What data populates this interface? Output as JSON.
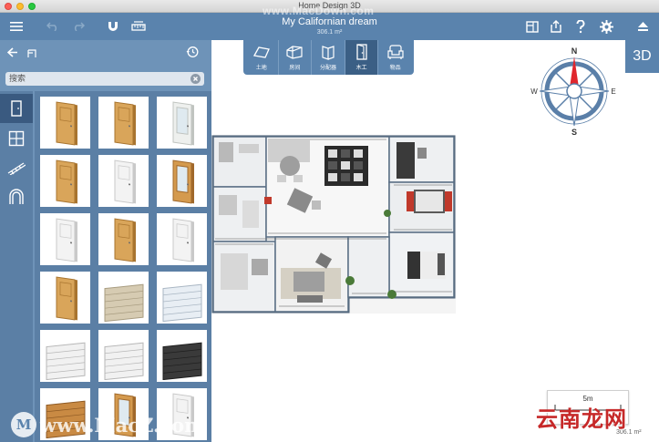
{
  "window": {
    "title": "Home Design 3D"
  },
  "watermarks": {
    "top": "www.MacDown.com",
    "bottom_left": "www.MacZ.com",
    "bottom_right": "云南龙网",
    "logo_letter": "M"
  },
  "document": {
    "title": "My Californian dream",
    "area": "306.1 m²"
  },
  "modes": [
    {
      "label": "土地",
      "icon": "land-icon"
    },
    {
      "label": "房间",
      "icon": "room-icon"
    },
    {
      "label": "分配器",
      "icon": "divider-icon"
    },
    {
      "label": "木工",
      "icon": "door-icon",
      "active": true
    },
    {
      "label": "物品",
      "icon": "armchair-icon"
    }
  ],
  "view_toggle": {
    "label": "3D"
  },
  "panel": {
    "search_placeholder": "搜索",
    "categories": [
      "door-icon",
      "window-icon",
      "stairs-icon",
      "arch-icon"
    ],
    "tiles": [
      "wood-door",
      "wood-door",
      "white-glass-door",
      "wood-door",
      "white-door",
      "wood-glass-door",
      "white-door",
      "wood-door",
      "white-door",
      "wood-door",
      "wood-slat-door",
      "white-panel-garage",
      "white-garage-door",
      "white-garage-door",
      "dark-garage-door",
      "wood-carved-door",
      "wood-glass-door",
      "white-door"
    ]
  },
  "compass": {
    "n": "N",
    "s": "S",
    "e": "E",
    "w": "W"
  },
  "scale": {
    "label": "5m"
  },
  "status": {
    "area": "306.1 m²"
  },
  "colors": {
    "toolbar": "#5a83ad",
    "panel": "#6e93b8",
    "active": "#3b5f85",
    "compass_red": "#e0262d"
  }
}
